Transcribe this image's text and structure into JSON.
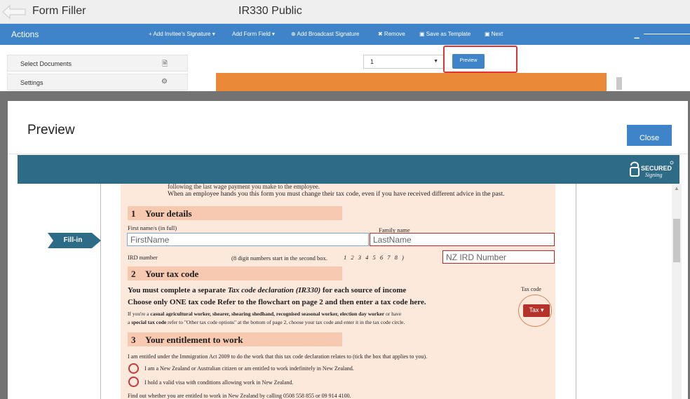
{
  "app": {
    "title": "Form Filler",
    "doc_title": "IR330 Public"
  },
  "actionbar": {
    "label": "Actions",
    "items": [
      "+ Add Invitee's Signature ▾",
      "Add Form Field ▾",
      "Add Broadcast Signature",
      "✖ Remove",
      "Save as Template",
      "Next"
    ],
    "collapse": "−"
  },
  "leftpanel": {
    "select_documents": "Select Documents",
    "settings": "Settings"
  },
  "page_select": {
    "value": "1"
  },
  "preview_button": "Preview",
  "modal": {
    "title": "Preview",
    "close": "Close",
    "fill_in": "Fill-in",
    "logo_text": "SECURED Signing"
  },
  "document": {
    "topline": "following the last wage payment you make to the employee.",
    "topline2": "When an employee hands you this form you must change their tax code, even if you have received different advice in the past.",
    "sec1": {
      "num": "1",
      "title": "Your details"
    },
    "first_name_label": "First name/s (in full)",
    "family_name_label": "Family name",
    "first_name_value": "FirstName",
    "last_name_value": "LastName",
    "ird_label": "IRD number",
    "ird_hint": "(8 digit numbers start in the second box.",
    "ird_digits": "1 2 3 4 5 6 7 8 )",
    "ird_value": "NZ IRD Number",
    "sec2": {
      "num": "2",
      "title": "Your tax code"
    },
    "line_a_pre": "You must complete a separate ",
    "line_a_ital": "Tax code declaration (IR330)",
    "line_a_post": " for each source of income",
    "line_b": "Choose only ONE tax code     Refer to the flowchart on page 2 and then enter a tax code here.",
    "para1_a": "If you're a ",
    "para1_b": "casual agricultural worker, shearer, shearing shedhand, recognised seasonal worker, election day worker",
    "para1_c": " or have",
    "para2_a": "a ",
    "para2_b": "special tax code",
    "para2_c": " refer to \"Other tax code options\" at the bottom of page 2, choose your tax code and enter it in the tax code circle.",
    "tax_code_label": "Tax code",
    "tax_button": "Tax ▾",
    "sec3": {
      "num": "3",
      "title": "Your entitlement to work"
    },
    "entitled_line": "I am entitled under the Immigration Act 2009 to do the work that this tax code declaration relates to (tick the box that applies to you).",
    "option1": "I am a New Zealand or Australian citizen or am entitled to work indefinitely in New Zealand.",
    "option2": "I hold a valid visa with conditions allowing work in New Zealand.",
    "find_out": "Find out whether you are entitled to work in New Zealand by calling 0508 558 855 or 09 914 4100."
  }
}
